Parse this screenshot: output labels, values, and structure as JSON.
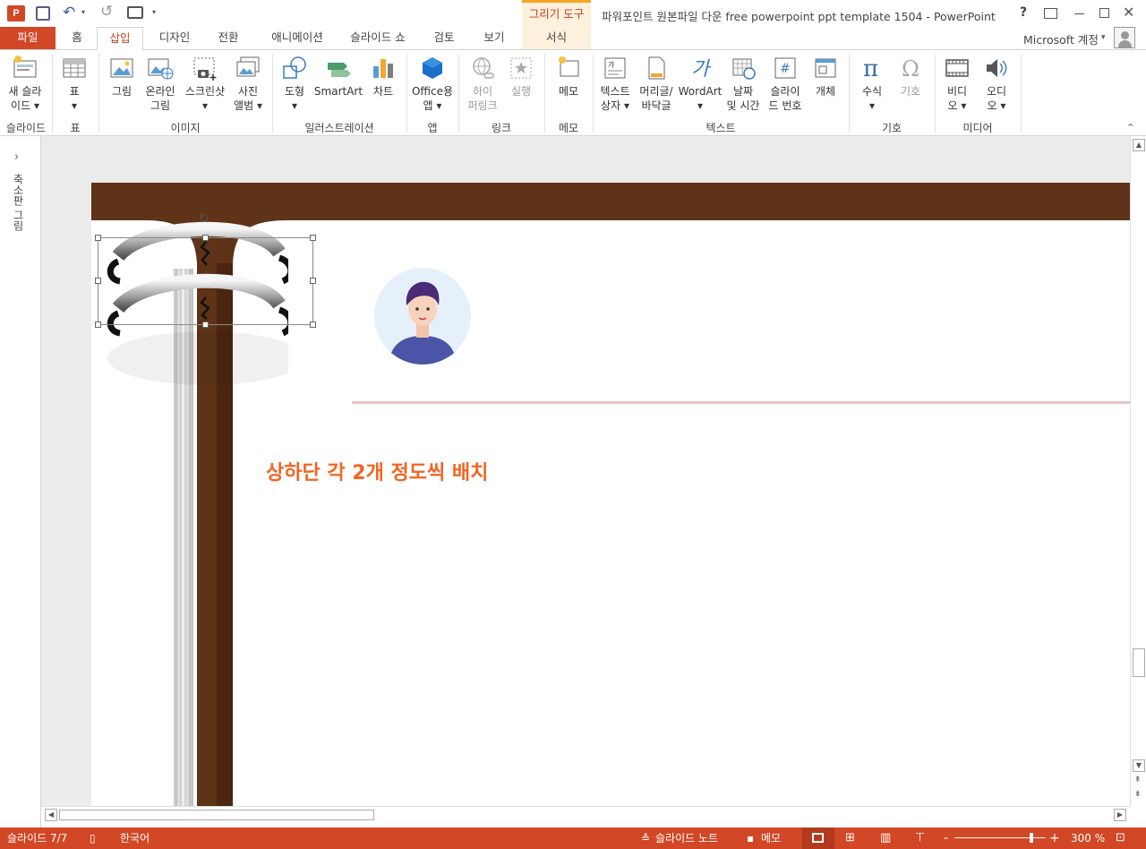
{
  "window": {
    "title": "파워포인트 원본파일 다운 free powerpoint ppt template 1504 - PowerPoint",
    "context_tool": "그리기 도구",
    "help": "?",
    "account": "Microsoft 계정"
  },
  "tabs": [
    "파일",
    "홈",
    "삽입",
    "디자인",
    "전환",
    "애니메이션",
    "슬라이드 쇼",
    "검토",
    "보기",
    "서식"
  ],
  "active_tab": "삽입",
  "ribbon": {
    "slides": {
      "btn1": "새 슬라",
      "btn2": "이드",
      "label": "슬라이드"
    },
    "table": {
      "btn": "표",
      "label": "표"
    },
    "images": {
      "picture": "그림",
      "online1": "온라인",
      "online2": "그림",
      "screenshot": "스크린샷",
      "album1": "사진",
      "album2": "앨범",
      "label": "이미지"
    },
    "illustrations": {
      "shapes": "도형",
      "smartart": "SmartArt",
      "chart": "차트",
      "label": "일러스트레이션"
    },
    "apps": {
      "office1": "Office용",
      "office2": "앱",
      "label": "앱"
    },
    "links": {
      "hyper1": "하이",
      "hyper2": "퍼링크",
      "action": "실행",
      "label": "링크"
    },
    "comments": {
      "memo": "메모",
      "label": "메모"
    },
    "text": {
      "textbox1": "텍스트",
      "textbox2": "상자",
      "header1": "머리글/",
      "header2": "바닥글",
      "wordart": "WordArt",
      "date1": "날짜",
      "date2": "및 시간",
      "slidenum1": "슬라이",
      "slidenum2": "드 번호",
      "object": "개체",
      "label": "텍스트"
    },
    "symbols": {
      "equation": "수식",
      "symbol": "기호",
      "label": "기호"
    },
    "media": {
      "video1": "비디",
      "video2": "오",
      "audio1": "오디",
      "audio2": "오",
      "label": "미디어"
    }
  },
  "left_pane": {
    "label": "축소판 그림"
  },
  "slide": {
    "annotation": "상하단 각 2개 정도씩 배치",
    "colors": {
      "brown": "#5e3317",
      "accent": "#f26522",
      "divider": "#e8c4c4"
    }
  },
  "status": {
    "slide_count": "슬라이드 7/7",
    "language": "한국어",
    "notes": "슬라이드 노트",
    "comments": "메모",
    "zoom": "300 %",
    "zoom_minus": "-",
    "zoom_plus": "+"
  }
}
